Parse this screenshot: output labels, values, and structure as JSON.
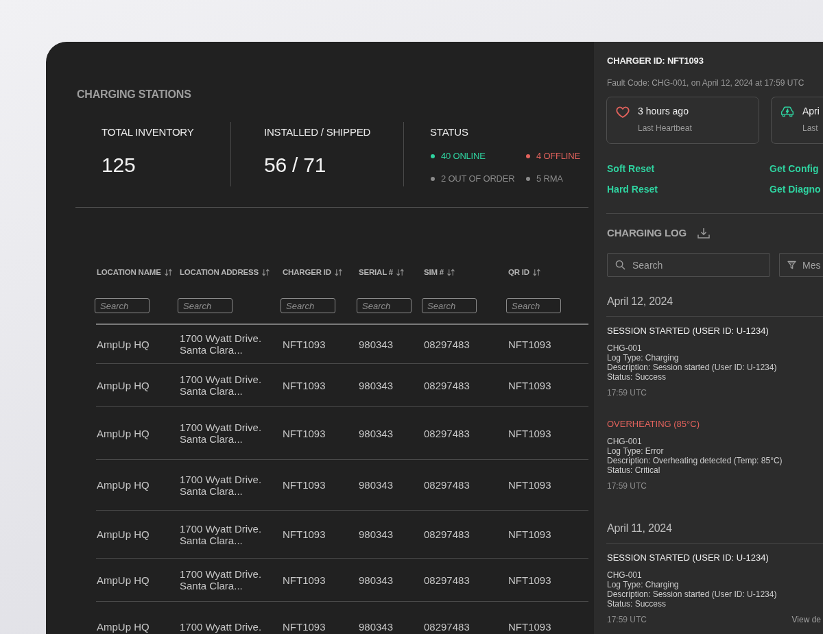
{
  "main": {
    "title": "CHARGING STATIONS",
    "stats": [
      {
        "label": "TOTAL INVENTORY",
        "value": "125"
      },
      {
        "label": "INSTALLED / SHIPPED",
        "value": "56 / 71"
      }
    ],
    "status": {
      "label": "STATUS",
      "items": [
        {
          "text": "40 ONLINE",
          "color": "#2fd3a0"
        },
        {
          "text": "4 OFFLINE",
          "color": "#e2625c"
        },
        {
          "text": "2 OUT OF ORDER",
          "color": "#8a8a8a"
        },
        {
          "text": "5 RMA",
          "color": "#8a8a8a"
        }
      ]
    }
  },
  "table": {
    "columns": [
      {
        "label": "LOCATION NAME",
        "placeholder": "Search"
      },
      {
        "label": "LOCATION ADDRESS",
        "placeholder": "Search"
      },
      {
        "label": "CHARGER ID",
        "placeholder": "Search"
      },
      {
        "label": "SERIAL #",
        "placeholder": "Search"
      },
      {
        "label": "SIM #",
        "placeholder": "Search"
      },
      {
        "label": "QR ID",
        "placeholder": "Search"
      }
    ],
    "rows": [
      [
        "AmpUp HQ",
        "1700 Wyatt Drive. Santa Clara...",
        "NFT1093",
        "980343",
        "08297483",
        "NFT1093"
      ],
      [
        "AmpUp HQ",
        "1700 Wyatt Drive. Santa Clara...",
        "NFT1093",
        "980343",
        "08297483",
        "NFT1093"
      ],
      [
        "AmpUp HQ",
        "1700 Wyatt Drive. Santa Clara...",
        "NFT1093",
        "980343",
        "08297483",
        "NFT1093"
      ],
      [
        "AmpUp HQ",
        "1700 Wyatt Drive. Santa Clara...",
        "NFT1093",
        "980343",
        "08297483",
        "NFT1093"
      ],
      [
        "AmpUp HQ",
        "1700 Wyatt Drive. Santa Clara...",
        "NFT1093",
        "980343",
        "08297483",
        "NFT1093"
      ],
      [
        "AmpUp HQ",
        "1700 Wyatt Drive. Santa Clara...",
        "NFT1093",
        "980343",
        "08297483",
        "NFT1093"
      ],
      [
        "AmpUp HQ",
        "1700 Wyatt Drive.",
        "NFT1093",
        "980343",
        "08297483",
        "NFT1093"
      ]
    ]
  },
  "detail": {
    "title": "CHARGER ID: NFT1093",
    "subtitle": "Fault Code: CHG-001, on April 12, 2024 at 17:59 UTC",
    "cards": [
      {
        "kind": "heartbeat",
        "value": "3 hours ago",
        "label": "Last Heartbeat"
      },
      {
        "kind": "charging",
        "value": "Apri",
        "label": "Last"
      }
    ],
    "actions": [
      "Soft Reset",
      "Get Config",
      "Hard Reset",
      "Get Diagno"
    ]
  },
  "log": {
    "title": "CHARGING LOG",
    "search": {
      "placeholder": "Search"
    },
    "filter": {
      "placeholder": "Mes"
    },
    "days": [
      {
        "date": "April 12, 2024",
        "entries": [
          {
            "kind": "info",
            "title": "SESSION STARTED (USER ID: U-1234)",
            "lines": [
              "CHG-001",
              "Log Type: Charging",
              "Description: Session started (User ID: U-1234)",
              "Status: Success"
            ],
            "time": "17:59 UTC"
          },
          {
            "kind": "error",
            "title": "OVERHEATING (85°C)",
            "lines": [
              "CHG-001",
              "Log Type: Error",
              "Description: Overheating detected (Temp: 85°C)",
              "Status: Critical"
            ],
            "time": "17:59 UTC"
          }
        ]
      },
      {
        "date": "April 11, 2024",
        "entries": [
          {
            "kind": "info",
            "title": "SESSION STARTED (USER ID: U-1234)",
            "lines": [
              "CHG-001",
              "Log Type: Charging",
              "Description: Session started (User ID: U-1234)",
              "Status: Success"
            ],
            "time": "17:59 UTC",
            "link": "View de"
          }
        ]
      }
    ]
  }
}
